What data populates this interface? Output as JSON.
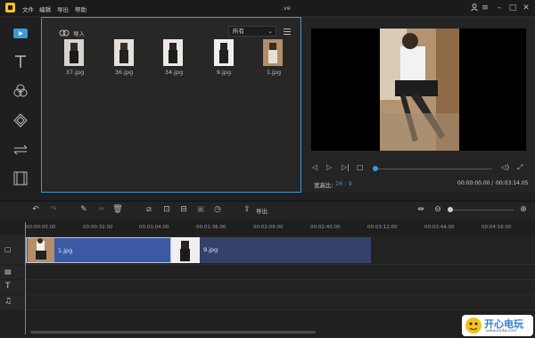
{
  "menu": [
    "文件",
    "编辑",
    "导出",
    "帮助"
  ],
  "window_title": ".ve",
  "media": {
    "import_label": "导入",
    "filter_value": "所有",
    "files": [
      "37.jpg",
      "36.jpg",
      "34.jpg",
      "9.jpg",
      "1.jpg"
    ]
  },
  "preview": {
    "aspect_label": "宽高比:",
    "aspect_value": "16 : 9",
    "time_current": "00:00:00.00",
    "time_separator": "/",
    "time_total": "00:03:14.05"
  },
  "toolbar": {
    "export_label": "导出"
  },
  "ruler_ticks": [
    "00:00:00.00",
    "00:00:32.00",
    "00:01:04.00",
    "00:01:36.00",
    "00:02:08.00",
    "00:02:40.00",
    "00:03:12.00",
    "00:03:44.00",
    "00:04:16.00"
  ],
  "clips": [
    {
      "label": "1.jpg"
    },
    {
      "label": "9.jpg"
    }
  ],
  "watermark": {
    "text": "开心电玩",
    "sub": "www.kxdw.com"
  },
  "colors": {
    "accent": "#3b9bd8",
    "clip_selected": "#3c5aa4",
    "clip": "#36406a",
    "logo": "#f6c21a"
  }
}
